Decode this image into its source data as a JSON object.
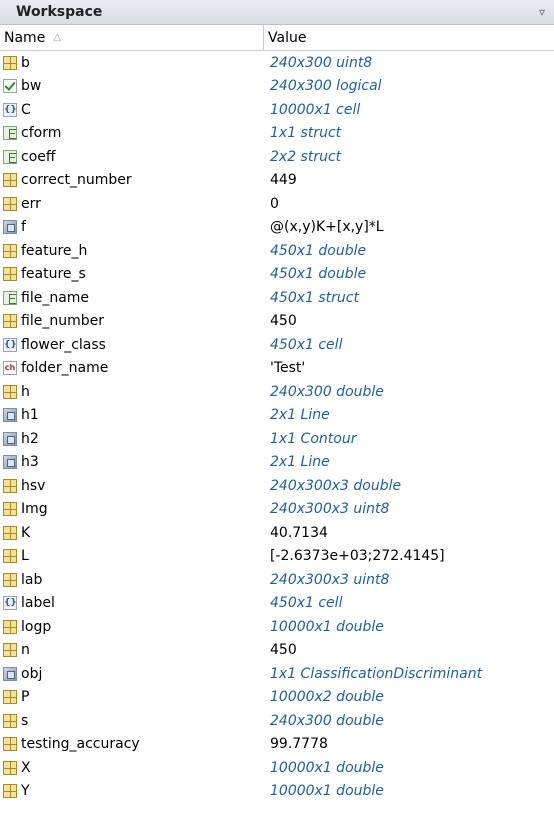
{
  "panel": {
    "title": "Workspace",
    "menu_icon": "circle-chevron-down-icon"
  },
  "columns": {
    "name": "Name",
    "sort_indicator": "△",
    "value": "Value"
  },
  "variables": [
    {
      "name": "b",
      "value": "240x300 uint8",
      "icon": "matrix",
      "italic": true
    },
    {
      "name": "bw",
      "value": "240x300 logical",
      "icon": "logical",
      "italic": true
    },
    {
      "name": "C",
      "value": "10000x1 cell",
      "icon": "cell",
      "italic": true
    },
    {
      "name": "cform",
      "value": "1x1 struct",
      "icon": "struct",
      "italic": true
    },
    {
      "name": "coeff",
      "value": "2x2 struct",
      "icon": "struct",
      "italic": true
    },
    {
      "name": "correct_number",
      "value": "449",
      "icon": "matrix",
      "italic": false
    },
    {
      "name": "err",
      "value": "0",
      "icon": "matrix",
      "italic": false
    },
    {
      "name": "f",
      "value": "@(x,y)K+[x,y]*L",
      "icon": "object",
      "italic": false
    },
    {
      "name": "feature_h",
      "value": "450x1 double",
      "icon": "matrix",
      "italic": true
    },
    {
      "name": "feature_s",
      "value": "450x1 double",
      "icon": "matrix",
      "italic": true
    },
    {
      "name": "file_name",
      "value": "450x1 struct",
      "icon": "struct",
      "italic": true
    },
    {
      "name": "file_number",
      "value": "450",
      "icon": "matrix",
      "italic": false
    },
    {
      "name": "flower_class",
      "value": "450x1 cell",
      "icon": "cell",
      "italic": true
    },
    {
      "name": "folder_name",
      "value": "'Test'",
      "icon": "char",
      "italic": false
    },
    {
      "name": "h",
      "value": "240x300 double",
      "icon": "matrix",
      "italic": true
    },
    {
      "name": "h1",
      "value": "2x1 Line",
      "icon": "object",
      "italic": true
    },
    {
      "name": "h2",
      "value": "1x1 Contour",
      "icon": "object",
      "italic": true
    },
    {
      "name": "h3",
      "value": "2x1 Line",
      "icon": "object",
      "italic": true
    },
    {
      "name": "hsv",
      "value": "240x300x3 double",
      "icon": "matrix",
      "italic": true
    },
    {
      "name": "Img",
      "value": "240x300x3 uint8",
      "icon": "matrix",
      "italic": true
    },
    {
      "name": "K",
      "value": "40.7134",
      "icon": "matrix",
      "italic": false
    },
    {
      "name": "L",
      "value": "[-2.6373e+03;272.4145]",
      "icon": "matrix",
      "italic": false
    },
    {
      "name": "lab",
      "value": "240x300x3 uint8",
      "icon": "matrix",
      "italic": true
    },
    {
      "name": "label",
      "value": "450x1 cell",
      "icon": "cell",
      "italic": true
    },
    {
      "name": "logp",
      "value": "10000x1 double",
      "icon": "matrix",
      "italic": true
    },
    {
      "name": "n",
      "value": "450",
      "icon": "matrix",
      "italic": false
    },
    {
      "name": "obj",
      "value": "1x1 ClassificationDiscriminant",
      "icon": "object",
      "italic": true
    },
    {
      "name": "P",
      "value": "10000x2 double",
      "icon": "matrix",
      "italic": true
    },
    {
      "name": "s",
      "value": "240x300 double",
      "icon": "matrix",
      "italic": true
    },
    {
      "name": "testing_accuracy",
      "value": "99.7778",
      "icon": "matrix",
      "italic": false
    },
    {
      "name": "X",
      "value": "10000x1 double",
      "icon": "matrix",
      "italic": true
    },
    {
      "name": "Y",
      "value": "10000x1 double",
      "icon": "matrix",
      "italic": true
    }
  ]
}
